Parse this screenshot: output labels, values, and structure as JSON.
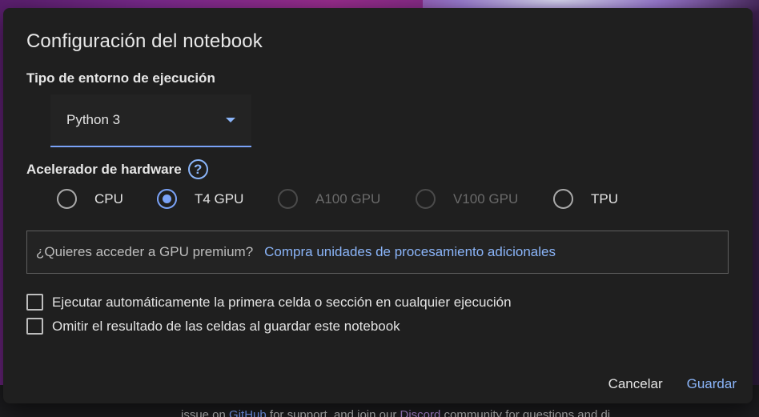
{
  "dialog": {
    "title": "Configuración del notebook",
    "runtime": {
      "label": "Tipo de entorno de ejecución",
      "selected": "Python 3"
    },
    "accelerator": {
      "label": "Acelerador de hardware",
      "help_icon_glyph": "?",
      "options": [
        {
          "label": "CPU",
          "checked": false,
          "disabled": false
        },
        {
          "label": "T4 GPU",
          "checked": true,
          "disabled": false
        },
        {
          "label": "A100 GPU",
          "checked": false,
          "disabled": true
        },
        {
          "label": "V100 GPU",
          "checked": false,
          "disabled": true
        },
        {
          "label": "TPU",
          "checked": false,
          "disabled": false
        }
      ]
    },
    "premium": {
      "question": "¿Quieres acceder a GPU premium?",
      "link": "Compra unidades de procesamiento adicionales"
    },
    "checkboxes": [
      {
        "label": "Ejecutar automáticamente la primera celda o sección en cualquier ejecución",
        "checked": false
      },
      {
        "label": "Omitir el resultado de las celdas al guardar este notebook",
        "checked": false
      }
    ],
    "actions": {
      "cancel": "Cancelar",
      "save": "Guardar"
    }
  },
  "background": {
    "footer_before": "issue on ",
    "footer_link1": "GitHub",
    "footer_mid": " for support, and join our ",
    "footer_link2": "Discord",
    "footer_after": " community for questions and di"
  },
  "colors": {
    "accent": "#8ab4f8",
    "dialog_bg": "#1f1f1f"
  }
}
